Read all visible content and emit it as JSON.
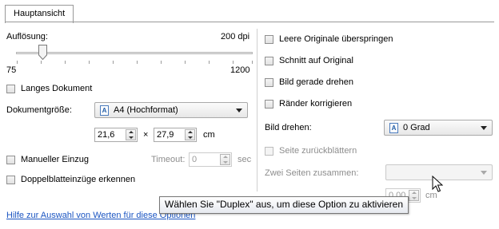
{
  "tabs": [
    {
      "label": "Hauptansicht"
    }
  ],
  "left": {
    "resolution_label": "Auflösung:",
    "resolution_value": "200 dpi",
    "slider_min": "75",
    "slider_max": "1200",
    "slider_level": 0.11,
    "long_document_label": "Langes Dokument",
    "doc_size_label": "Dokumentgröße:",
    "doc_size_value": "A4 (Hochformat)",
    "width_value": "21,6",
    "times_sign": "×",
    "height_value": "27,9",
    "unit": "cm",
    "manual_feed_label": "Manueller Einzug",
    "timeout_label": "Timeout:",
    "timeout_value": "0",
    "timeout_unit": "sec",
    "double_feed_label": "Doppelblatteinzüge erkennen"
  },
  "right": {
    "skip_blank_label": "Leere Originale überspringen",
    "crop_label": "Schnitt auf Original",
    "straighten_label": "Bild gerade drehen",
    "edge_label": "Ränder korrigieren",
    "rotate_label": "Bild drehen:",
    "rotate_value": "0 Grad",
    "flip_label": "Seite zurückblättern",
    "merge_label": "Zwei Seiten zusammen:",
    "merge_value": "",
    "hidden_value": "0,00",
    "hidden_unit": "cm"
  },
  "footer": {
    "help_link": "Hilfe zur Auswahl von Werten für diese Optionen"
  },
  "tooltip": {
    "text": "Wählen Sie \"Duplex\" aus, um diese Option zu aktivieren"
  },
  "icons": {
    "doc": "document-icon",
    "cursor": "mouse-pointer-icon"
  }
}
